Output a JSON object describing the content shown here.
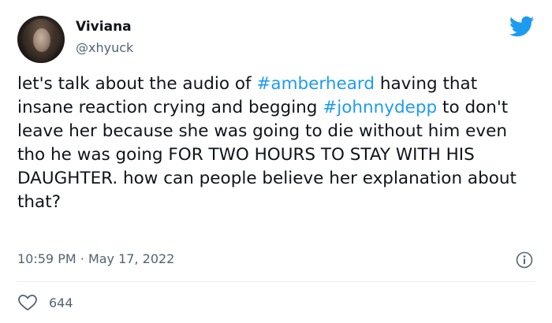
{
  "user": {
    "display_name": "Viviana",
    "handle": "@xhyuck"
  },
  "tweet": {
    "segments": [
      {
        "text": "let's talk about the audio of ",
        "type": "text"
      },
      {
        "text": "#amberheard",
        "type": "hashtag"
      },
      {
        "text": " having that insane reaction crying and begging ",
        "type": "text"
      },
      {
        "text": "#johnnydepp",
        "type": "hashtag"
      },
      {
        "text": " to don't leave her because she was going to die without him even tho he was going FOR TWO HOURS TO STAY WITH HIS DAUGHTER. how can people believe her explanation about that?",
        "type": "text"
      }
    ]
  },
  "meta": {
    "time": "10:59 PM",
    "separator": "·",
    "date": "May 17, 2022"
  },
  "engagement": {
    "likes": "644"
  },
  "icons": {
    "logo": "twitter-bird-icon",
    "info": "info-icon",
    "like": "heart-icon"
  },
  "colors": {
    "brand": "#1d9bf0",
    "text": "#0f1419",
    "secondary": "#536471",
    "divider": "#e6ecf0"
  }
}
